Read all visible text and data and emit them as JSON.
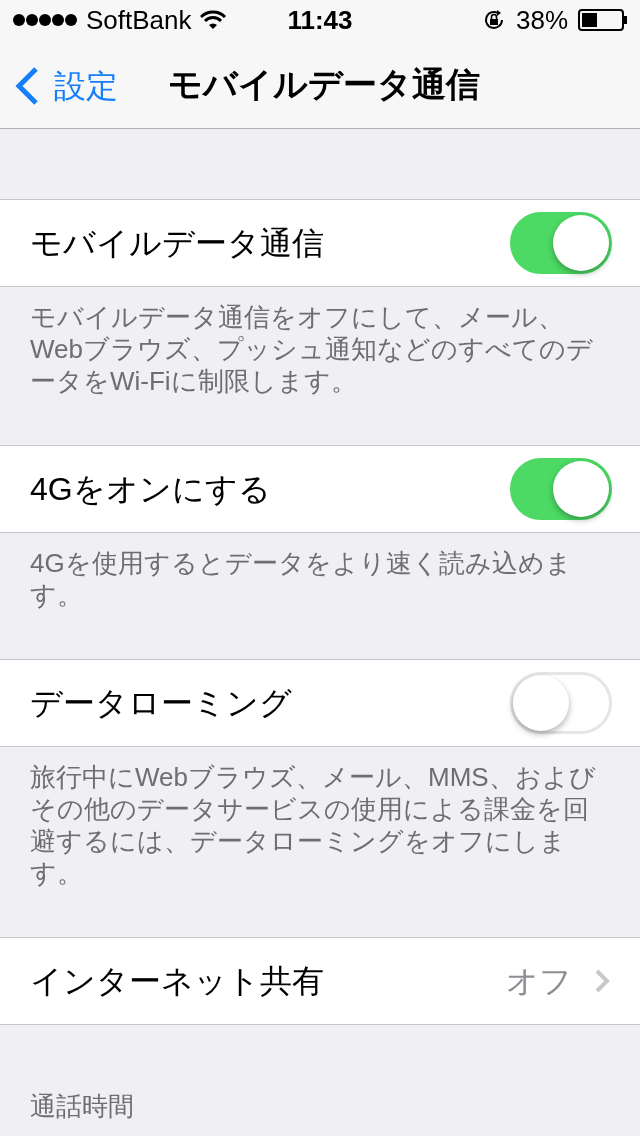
{
  "status_bar": {
    "carrier": "SoftBank",
    "time": "11:43",
    "battery": "38%"
  },
  "nav": {
    "back": "設定",
    "title": "モバイルデータ通信"
  },
  "sections": [
    {
      "kind": "toggle",
      "label": "モバイルデータ通信",
      "on": true,
      "footer": "モバイルデータ通信をオフにして、メール、Webブラウズ、プッシュ通知などのすべてのデータをWi-Fiに制限します。"
    },
    {
      "kind": "toggle",
      "label": "4Gをオンにする",
      "on": true,
      "footer": "4Gを使用するとデータをより速く読み込めます。"
    },
    {
      "kind": "toggle",
      "label": "データローミング",
      "on": false,
      "footer": "旅行中にWebブラウズ、メール、MMS、およびその他のデータサービスの使用による課金を回避するには、データローミングをオフにします。"
    },
    {
      "kind": "link",
      "label": "インターネット共有",
      "value": "オフ"
    }
  ],
  "section_header": "通話時間"
}
